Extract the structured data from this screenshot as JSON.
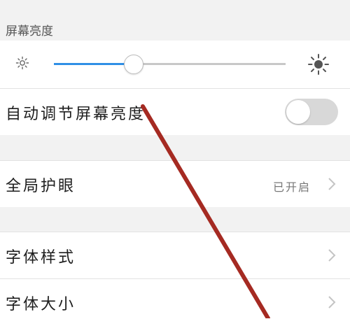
{
  "brightness_section": {
    "header": "屏幕亮度",
    "level": 0.34
  },
  "auto_brightness": {
    "label": "自动调节屏幕亮度",
    "enabled": false
  },
  "eye_protection": {
    "label": "全局护眼",
    "status": "已开启"
  },
  "font_style": {
    "label": "字体样式"
  },
  "font_size": {
    "label": "字体大小"
  },
  "colors": {
    "accent": "#2f8fe6",
    "annotation": "#a52a22"
  },
  "icons": {
    "brightness_low": "sun-small-icon",
    "brightness_high": "sun-large-icon",
    "chevron": "chevron-right-icon"
  }
}
